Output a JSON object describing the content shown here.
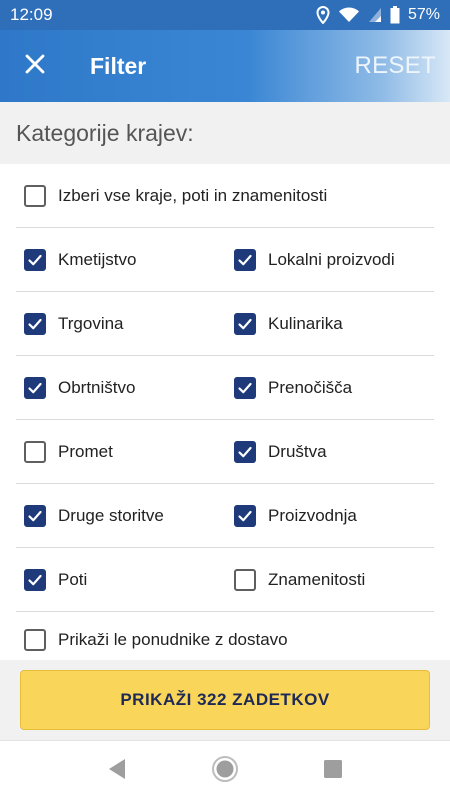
{
  "status_bar": {
    "time": "12:09",
    "battery": "57%"
  },
  "app_bar": {
    "title": "Filter",
    "reset_label": "RESET"
  },
  "section": {
    "title": "Kategorije krajev:"
  },
  "select_all": {
    "label": "Izberi vse kraje, poti in znamenitosti",
    "checked": false
  },
  "categories": [
    {
      "label": "Kmetijstvo",
      "checked": true
    },
    {
      "label": "Lokalni proizvodi",
      "checked": true
    },
    {
      "label": "Trgovina",
      "checked": true
    },
    {
      "label": "Kulinarika",
      "checked": true
    },
    {
      "label": "Obrtništvo",
      "checked": true
    },
    {
      "label": "Prenočišča",
      "checked": true
    },
    {
      "label": "Promet",
      "checked": false
    },
    {
      "label": "Društva",
      "checked": true
    },
    {
      "label": "Druge storitve",
      "checked": true
    },
    {
      "label": "Proizvodnja",
      "checked": true
    },
    {
      "label": "Poti",
      "checked": true
    },
    {
      "label": "Znamenitosti",
      "checked": false
    }
  ],
  "delivery_only": {
    "label": "Prikaži le ponudnike z dostavo",
    "checked": false
  },
  "show_results_button": {
    "label": "PRIKAŽI 322 ZADETKOV"
  },
  "colors": {
    "appbar": "#2f78c9",
    "checkbox_checked": "#1f3a7a",
    "button": "#f9d55a"
  }
}
